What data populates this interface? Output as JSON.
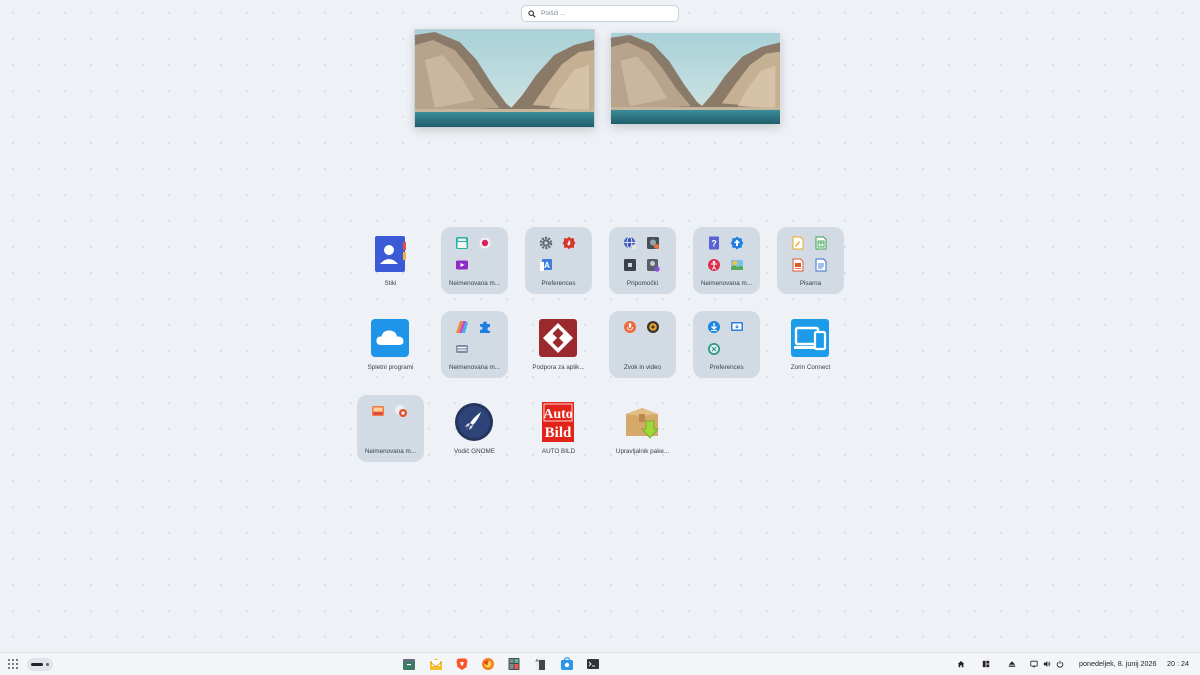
{
  "search": {
    "placeholder": "Poišči ..."
  },
  "workspaces": [
    {
      "name": "workspace-1"
    },
    {
      "name": "workspace-2"
    }
  ],
  "apps": [
    {
      "label": "Stiki",
      "kind": "app",
      "icon": "contacts-icon"
    },
    {
      "label": "Neimenovana m...",
      "kind": "folder",
      "icons": [
        "screenshot-icon",
        "record-icon",
        "video-icon"
      ]
    },
    {
      "label": "Preferences",
      "kind": "folder",
      "icons": [
        "settings-gear-icon",
        "firewall-icon",
        "font-icon"
      ]
    },
    {
      "label": "Pripomočki",
      "kind": "folder",
      "icons": [
        "network-globe-icon",
        "disks-icon",
        "screen-icon",
        "user-settings-icon"
      ]
    },
    {
      "label": "Neimenovana m...",
      "kind": "folder",
      "icons": [
        "help-icon",
        "update-icon",
        "accessibility-icon",
        "weather-icon"
      ]
    },
    {
      "label": "Pisarna",
      "kind": "folder",
      "icons": [
        "draw-icon",
        "calc-icon",
        "impress-icon",
        "writer-icon"
      ]
    },
    {
      "label": "Spletni programi",
      "kind": "app",
      "icon": "cloud-icon"
    },
    {
      "label": "Neimenovana m...",
      "kind": "folder",
      "icons": [
        "paint-icon",
        "extensions-icon",
        "keyboard-icon"
      ]
    },
    {
      "label": "Podpora za aplik...",
      "kind": "app",
      "icon": "wine-icon"
    },
    {
      "label": "Zvok in video",
      "kind": "folder",
      "icons": [
        "microphone-icon",
        "speaker-icon"
      ]
    },
    {
      "label": "Preferences",
      "kind": "folder",
      "icons": [
        "download-icon",
        "remote-desktop-icon",
        "sync-icon"
      ]
    },
    {
      "label": "Zorin Connect",
      "kind": "app",
      "icon": "zorin-connect-icon"
    },
    {
      "label": "Neimenovana m...",
      "kind": "folder",
      "icons": [
        "photos-icon",
        "camera-icon"
      ]
    },
    {
      "label": "Vodič GNOME",
      "kind": "app",
      "icon": "rocket-icon"
    },
    {
      "label": "AUTO BILD",
      "kind": "app",
      "icon": "autobild-icon",
      "brand": "Auto Bild"
    },
    {
      "label": "Upravljalnik pake...",
      "kind": "app",
      "icon": "package-icon"
    }
  ],
  "taskbar": {
    "apps": [
      "files-icon",
      "mail-icon",
      "brave-icon",
      "firefox-icon",
      "calculator-icon",
      "text-editor-icon",
      "store-icon",
      "terminal-icon"
    ],
    "tray": [
      "home-icon",
      "layout-icon",
      "eject-icon",
      "display-icon",
      "volume-icon",
      "power-icon"
    ],
    "date": "ponedeljek, 8. junij 2026",
    "time": "20 : 24"
  },
  "colors": {
    "background": "#eef2f6",
    "folder": "#d2dbe3",
    "taskbar": "#f3f5f8",
    "accent": "#3c7fd8"
  }
}
